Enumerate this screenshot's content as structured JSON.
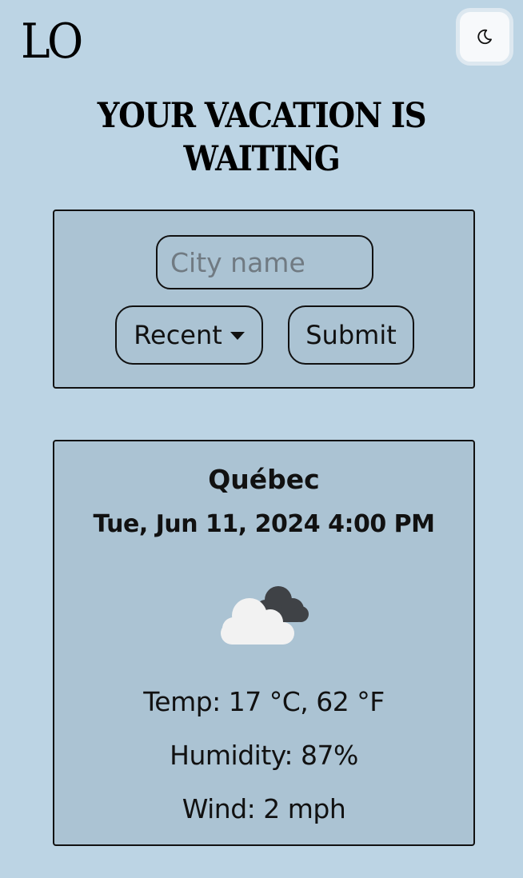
{
  "header": {
    "logo_text": "LO",
    "theme_toggle_icon": "moon-icon"
  },
  "hero": {
    "headline": "YOUR VACATION IS WAITING"
  },
  "search": {
    "city_placeholder": "City name",
    "city_value": "",
    "recent_label": "Recent",
    "recent_icon": "caret-down-icon",
    "submit_label": "Submit"
  },
  "weather": {
    "city": "Québec",
    "datetime": "Tue, Jun 11, 2024 4:00 PM",
    "condition_icon": "partly-cloudy-icon",
    "temp": "Temp: 17 °C, 62 °F",
    "humidity": "Humidity: 87%",
    "wind": "Wind: 2 mph"
  },
  "colors": {
    "page_background": "#bcd4e4",
    "card_background": "#abc3d3",
    "border": "#111111",
    "toggle_background": "#f7f9fb"
  }
}
